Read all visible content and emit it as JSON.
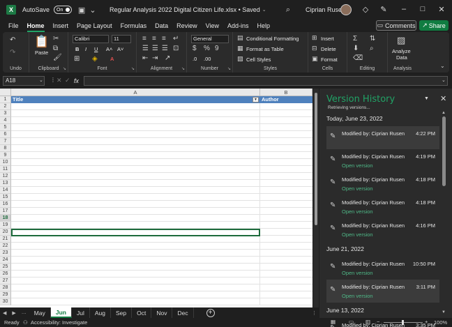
{
  "titlebar": {
    "app_icon": "X",
    "autosave_label": "AutoSave",
    "autosave_state": "On",
    "doc_title": "Regular Analysis 2022 Digital Citizen Life.xlsx • Saved",
    "user_name": "Ciprian Rusen"
  },
  "menu": {
    "tabs": [
      "File",
      "Home",
      "Insert",
      "Page Layout",
      "Formulas",
      "Data",
      "Review",
      "View",
      "Add-ins",
      "Help"
    ],
    "active": "Home",
    "comments_label": "Comments",
    "share_label": "Share"
  },
  "ribbon": {
    "undo_label": "Undo",
    "clipboard_label": "Clipboard",
    "paste_label": "Paste",
    "font_label": "Font",
    "font_name": "Calibri",
    "font_size": "11",
    "alignment_label": "Alignment",
    "number_label": "Number",
    "number_format": "General",
    "styles_label": "Styles",
    "conditional_formatting": "Conditional Formatting",
    "format_as_table": "Format as Table",
    "cell_styles": "Cell Styles",
    "cells_label": "Cells",
    "insert": "Insert",
    "delete": "Delete",
    "format": "Format",
    "editing_label": "Editing",
    "analysis_label": "Analysis",
    "analyze_data_line1": "Analyze",
    "analyze_data_line2": "Data"
  },
  "formula": {
    "name_box": "A18",
    "fx": "fx"
  },
  "sheet": {
    "columns": [
      "A",
      "B"
    ],
    "rows": [
      "1",
      "2",
      "3",
      "4",
      "5",
      "6",
      "7",
      "8",
      "9",
      "10",
      "11",
      "12",
      "13",
      "14",
      "15",
      "16",
      "17",
      "18",
      "19",
      "20",
      "21",
      "22",
      "23",
      "24",
      "25",
      "26",
      "27",
      "28",
      "29",
      "30"
    ],
    "selected_row": "18",
    "header_title": "Title",
    "header_author": "Author"
  },
  "tabs": {
    "items": [
      "May",
      "Jun",
      "Jul",
      "Aug",
      "Sep",
      "Oct",
      "Nov",
      "Dec"
    ],
    "active": "Jun"
  },
  "status": {
    "ready": "Ready",
    "accessibility": "Accessibility: Investigate",
    "zoom": "100%"
  },
  "version_history": {
    "title": "Version History",
    "status": "Retrieving versions...",
    "groups": [
      {
        "date": "Today, June 23, 2022",
        "entries": [
          {
            "by": "Modified by: Ciprian Rusen",
            "time": "4:22 PM",
            "open": "",
            "highlighted": true
          },
          {
            "by": "Modified by: Ciprian Rusen",
            "time": "4:19 PM",
            "open": "Open version",
            "highlighted": false
          },
          {
            "by": "Modified by: Ciprian Rusen",
            "time": "4:18 PM",
            "open": "Open version",
            "highlighted": false
          },
          {
            "by": "Modified by: Ciprian Rusen",
            "time": "4:18 PM",
            "open": "Open version",
            "highlighted": false
          },
          {
            "by": "Modified by: Ciprian Rusen",
            "time": "4:16 PM",
            "open": "Open version",
            "highlighted": false
          }
        ]
      },
      {
        "date": "June 21, 2022",
        "entries": [
          {
            "by": "Modified by: Ciprian Rusen",
            "time": "10:50 PM",
            "open": "Open version",
            "highlighted": false
          },
          {
            "by": "Modified by: Ciprian Rusen",
            "time": "3:11 PM",
            "open": "Open version",
            "highlighted": true
          }
        ]
      },
      {
        "date": "June 13, 2022",
        "entries": [
          {
            "by": "Modified by: Ciprian Rusen",
            "time": "3:35 PM",
            "open": "",
            "highlighted": false
          }
        ]
      }
    ]
  }
}
